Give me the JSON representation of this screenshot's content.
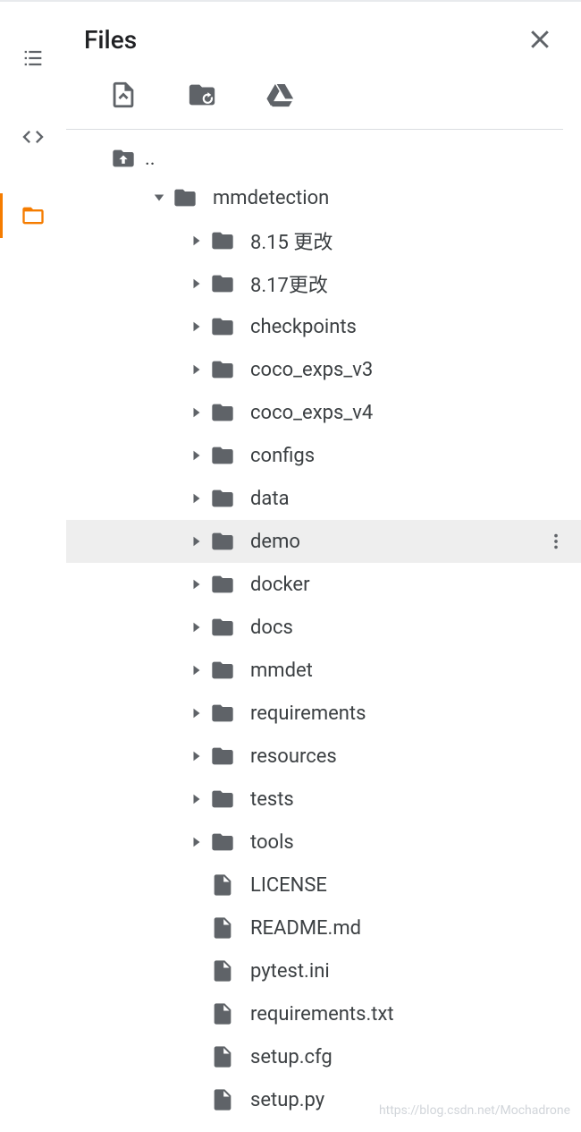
{
  "header": {
    "title": "Files"
  },
  "tree": {
    "parent_label": "..",
    "root": {
      "name": "mmdetection",
      "expanded": true,
      "children": [
        {
          "name": "8.15 更改",
          "type": "folder"
        },
        {
          "name": "8.17更改",
          "type": "folder"
        },
        {
          "name": "checkpoints",
          "type": "folder"
        },
        {
          "name": "coco_exps_v3",
          "type": "folder"
        },
        {
          "name": "coco_exps_v4",
          "type": "folder"
        },
        {
          "name": "configs",
          "type": "folder"
        },
        {
          "name": "data",
          "type": "folder"
        },
        {
          "name": "demo",
          "type": "folder",
          "hovered": true
        },
        {
          "name": "docker",
          "type": "folder"
        },
        {
          "name": "docs",
          "type": "folder"
        },
        {
          "name": "mmdet",
          "type": "folder"
        },
        {
          "name": "requirements",
          "type": "folder"
        },
        {
          "name": "resources",
          "type": "folder"
        },
        {
          "name": "tests",
          "type": "folder"
        },
        {
          "name": "tools",
          "type": "folder"
        },
        {
          "name": "LICENSE",
          "type": "file"
        },
        {
          "name": "README.md",
          "type": "file"
        },
        {
          "name": "pytest.ini",
          "type": "file"
        },
        {
          "name": "requirements.txt",
          "type": "file"
        },
        {
          "name": "setup.cfg",
          "type": "file"
        },
        {
          "name": "setup.py",
          "type": "file"
        }
      ]
    }
  },
  "watermark": "https://blog.csdn.net/Mochadrone"
}
